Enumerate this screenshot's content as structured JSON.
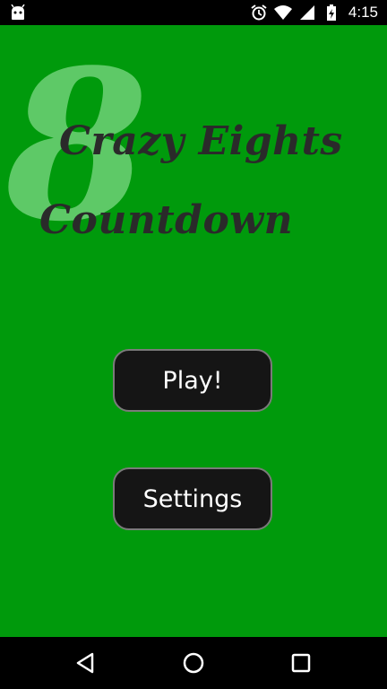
{
  "status_bar": {
    "time": "4:15",
    "left_icon": "android-robot-icon",
    "icons": [
      "alarm-icon",
      "wifi-icon",
      "signal-icon",
      "battery-charging-icon"
    ]
  },
  "title": {
    "emblem": "8",
    "line1": "Crazy Eights",
    "line2": "Countdown"
  },
  "menu": {
    "play_label": "Play!",
    "settings_label": "Settings"
  },
  "nav_bar": {
    "icons": [
      "back-icon",
      "home-icon",
      "recents-icon"
    ]
  },
  "colors": {
    "background": "#009a0c",
    "emblem": "#64cc6c",
    "title_text": "#2a2a2a",
    "button_bg": "#151515",
    "button_border": "#7a7a7a"
  }
}
